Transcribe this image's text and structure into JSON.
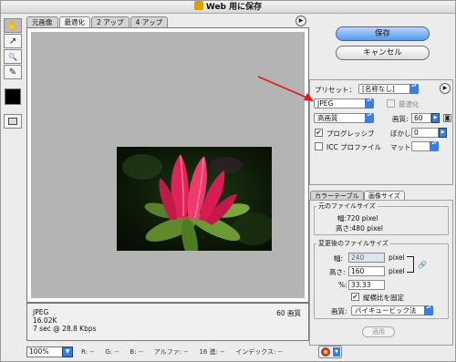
{
  "window": {
    "title": "Web 用に保存"
  },
  "tabs": [
    {
      "label": "元画像"
    },
    {
      "label": "最適化"
    },
    {
      "label": "2 アップ"
    },
    {
      "label": "4 アップ"
    }
  ],
  "tools": [
    {
      "icon": "hand-icon",
      "glyph": "✋"
    },
    {
      "icon": "slice-select-icon",
      "glyph": "↗"
    },
    {
      "icon": "zoom-icon",
      "glyph": "🔍"
    },
    {
      "icon": "eyedropper-icon",
      "glyph": "✎"
    }
  ],
  "preview_info": {
    "format": "JPEG",
    "size": "16.02K",
    "download_time": "7 sec @ 28.8 Kbps",
    "quality_label": "60 画質"
  },
  "status_bar": {
    "zoom": "100%",
    "r": "R:",
    "r_val": "--",
    "g": "G:",
    "g_val": "--",
    "b": "B:",
    "b_val": "--",
    "alpha": "アルファ:",
    "alpha_val": "--",
    "hex": "16 進:",
    "hex_val": "--",
    "index": "インデックス:",
    "index_val": "--"
  },
  "buttons": {
    "save": "保存",
    "cancel": "キャンセル",
    "apply": "適用"
  },
  "settings": {
    "preset_label": "プリセット：",
    "preset_value": "[名称なし]",
    "format_value": "JPEG",
    "optimize_label": "最適化",
    "quality_preset": "高画質",
    "quality_label": "画質:",
    "quality_value": "60",
    "progressive_label": "プログレッシブ",
    "blur_label": "ぼかし:",
    "blur_value": "0",
    "icc_label": "ICC プロファイル",
    "matte_label": "マット:",
    "matte_value": ""
  },
  "panel_tabs": {
    "color_table": "カラーテーブル",
    "image_size": "画像サイズ"
  },
  "image_size": {
    "original_title": "元のファイルサイズ",
    "orig_width": "幅:720 pixel",
    "orig_height": "高さ:480 pixel",
    "new_title": "変更後のファイルサイズ",
    "width_label": "幅:",
    "width_value": "240",
    "height_label": "高さ:",
    "height_value": "160",
    "percent_label": "%:",
    "percent_value": "33.33",
    "unit": "pixel",
    "constrain_label": "縦横比を固定",
    "quality_label": "画質:",
    "resample_value": "バイキュービック法"
  },
  "colors": {
    "accent": "#3a7de0",
    "save_button": "#5a98ec",
    "annotation_arrow": "#e01818"
  }
}
